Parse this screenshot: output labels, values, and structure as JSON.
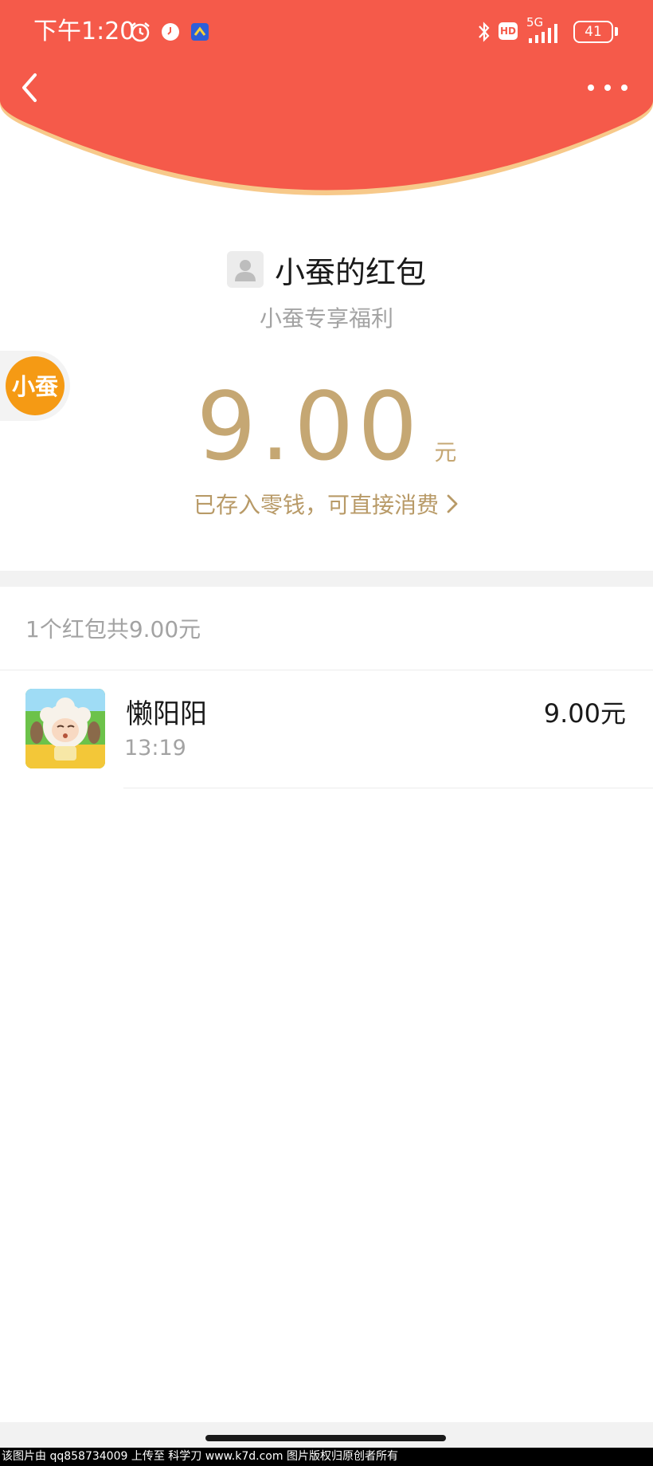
{
  "status_bar": {
    "time": "下午1:20",
    "battery": "41",
    "network": "5G",
    "hd": "HD"
  },
  "nav": {
    "back_icon": "chevron-left-icon",
    "more_icon": "more-dots-icon"
  },
  "red_packet": {
    "sender_title": "小蚕的红包",
    "subtitle": "小蚕专享福利",
    "amount": "9.00",
    "unit": "元",
    "stored_text": "已存入零钱，可直接消费",
    "floating_badge": "小蚕"
  },
  "summary": {
    "text": "1个红包共9.00元"
  },
  "records": [
    {
      "name": "懒阳阳",
      "time": "13:19",
      "amount": "9.00元"
    }
  ],
  "watermark": "该图片由 qq858734009 上传至 科学刀 www.k7d.com 图片版权归原创者所有",
  "colors": {
    "header_red": "#f55a4a",
    "header_edge": "#f7c98a",
    "gold": "#c5a773",
    "badge_orange": "#f59a14"
  }
}
